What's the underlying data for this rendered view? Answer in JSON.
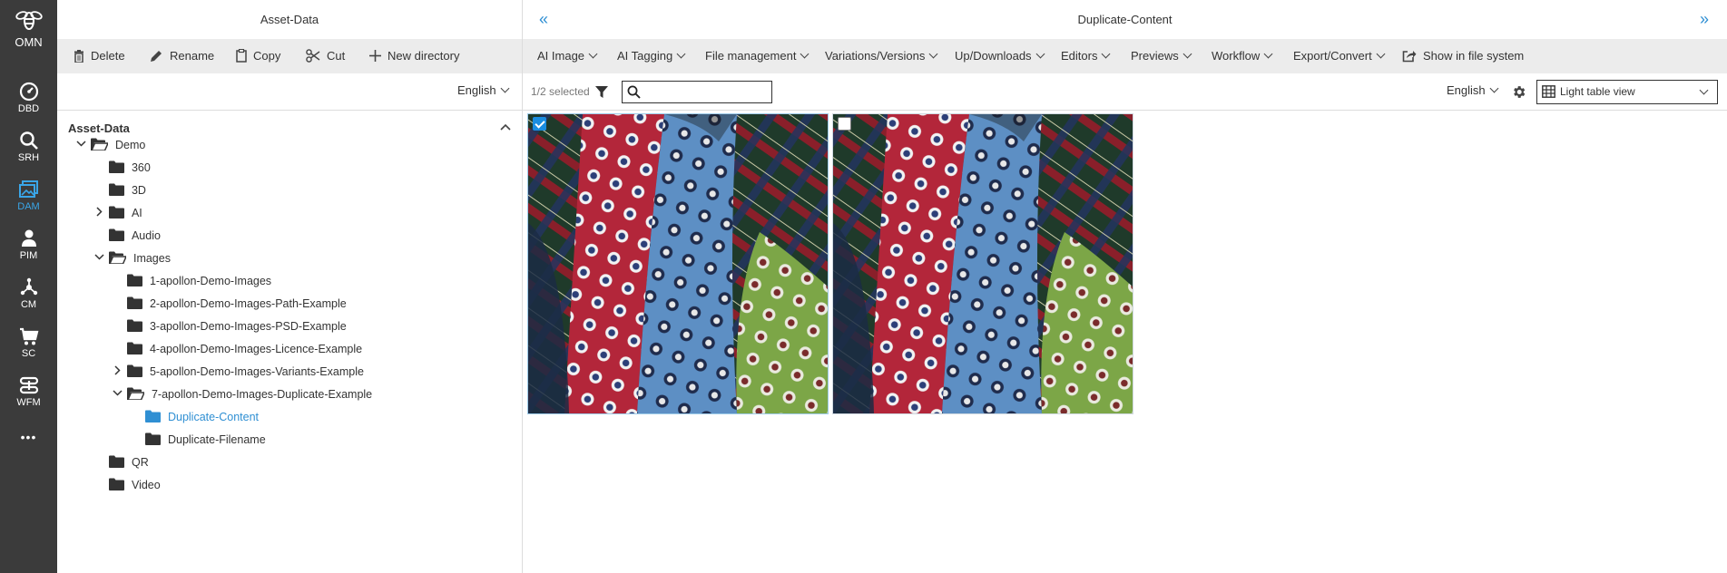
{
  "rail": {
    "logo_label": "OMN",
    "items": [
      {
        "label": "DBD"
      },
      {
        "label": "SRH"
      },
      {
        "label": "DAM"
      },
      {
        "label": "PIM"
      },
      {
        "label": "CM"
      },
      {
        "label": "SC"
      },
      {
        "label": "WFM"
      }
    ],
    "more_label": "•••"
  },
  "left": {
    "title": "Asset-Data",
    "toolbar": {
      "delete": "Delete",
      "rename": "Rename",
      "copy": "Copy",
      "cut": "Cut",
      "new_directory": "New directory"
    },
    "language": "English",
    "tree_title": "Asset-Data",
    "tree": [
      {
        "label": "Demo"
      },
      {
        "label": "360"
      },
      {
        "label": "3D"
      },
      {
        "label": "AI"
      },
      {
        "label": "Audio"
      },
      {
        "label": "Images"
      },
      {
        "label": "1-apollon-Demo-Images"
      },
      {
        "label": "2-apollon-Demo-Images-Path-Example"
      },
      {
        "label": "3-apollon-Demo-Images-PSD-Example"
      },
      {
        "label": "4-apollon-Demo-Images-Licence-Example"
      },
      {
        "label": "5-apollon-Demo-Images-Variants-Example"
      },
      {
        "label": "7-apollon-Demo-Images-Duplicate-Example"
      },
      {
        "label": "Duplicate-Content"
      },
      {
        "label": "Duplicate-Filename"
      },
      {
        "label": "QR"
      },
      {
        "label": "Video"
      }
    ]
  },
  "right": {
    "title": "Duplicate-Content",
    "menus": [
      {
        "label": "AI Image"
      },
      {
        "label": "AI Tagging"
      },
      {
        "label": "File management"
      },
      {
        "label": "Variations/Versions"
      },
      {
        "label": "Up/Downloads"
      },
      {
        "label": "Editors"
      },
      {
        "label": "Previews"
      },
      {
        "label": "Workflow"
      },
      {
        "label": "Export/Convert"
      }
    ],
    "show_in_fs": "Show in file system",
    "selected_count": "1/2 selected",
    "search_placeholder": "",
    "language": "English",
    "view": "Light table view",
    "thumbs": [
      {
        "checked": true
      },
      {
        "checked": false
      }
    ],
    "colors": {
      "accent": "#2f8fd3",
      "rail": "#3b3b3b",
      "toolbar": "#ececec"
    }
  }
}
